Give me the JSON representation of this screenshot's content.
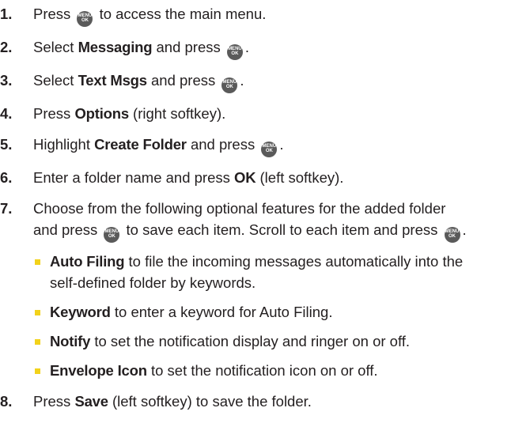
{
  "menu_key": {
    "top": "MENU",
    "bottom": "OK"
  },
  "steps": [
    {
      "num": "1.",
      "a": "Press ",
      "b": " to access the main menu."
    },
    {
      "num": "2.",
      "a": "Select ",
      "bold": "Messaging",
      "b": " and press ",
      "c": "."
    },
    {
      "num": "3.",
      "a": "Select ",
      "bold": "Text Msgs",
      "b": " and press ",
      "c": "."
    },
    {
      "num": "4.",
      "a": "Press ",
      "bold": "Options",
      "b": " (right softkey)."
    },
    {
      "num": "5.",
      "a": "Highlight ",
      "bold": "Create Folder",
      "b": " and press ",
      "c": "."
    },
    {
      "num": "6.",
      "a": "Enter a folder name and press ",
      "bold": "OK",
      "b": " (left softkey)."
    },
    {
      "num": "7.",
      "line1": "Choose from the following optional features for the added folder",
      "a": "and press ",
      "b": " to save each item. Scroll to each item and press ",
      "c": "."
    },
    {
      "num": "8.",
      "a": "Press ",
      "bold": "Save",
      "b": " (left softkey) to save the folder."
    }
  ],
  "bullets": [
    {
      "bold": "Auto Filing",
      "text": " to file the incoming messages automatically into the",
      "text2": "self-defined folder by keywords."
    },
    {
      "bold": "Keyword",
      "text": " to enter a keyword for Auto Filing."
    },
    {
      "bold": "Notify",
      "text": " to set the notification display and ringer on or off."
    },
    {
      "bold": "Envelope Icon",
      "text": " to set the notification icon on or off."
    }
  ]
}
